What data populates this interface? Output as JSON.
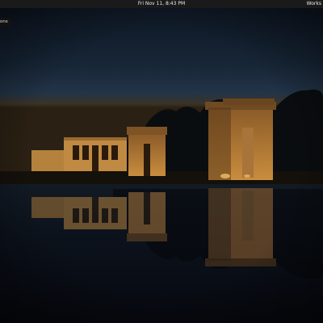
{
  "top_bar": {
    "clock": "Fri Nov 11,  8:43 PM",
    "workspaces_label": "Works"
  },
  "dash": {
    "label": "ons"
  },
  "colors": {
    "sky_top": "#101a28",
    "sky_mid": "#1f3347",
    "horizon": "#3a2a1a",
    "stone_lit": "#b07a3a",
    "water": "#0a0e16"
  }
}
